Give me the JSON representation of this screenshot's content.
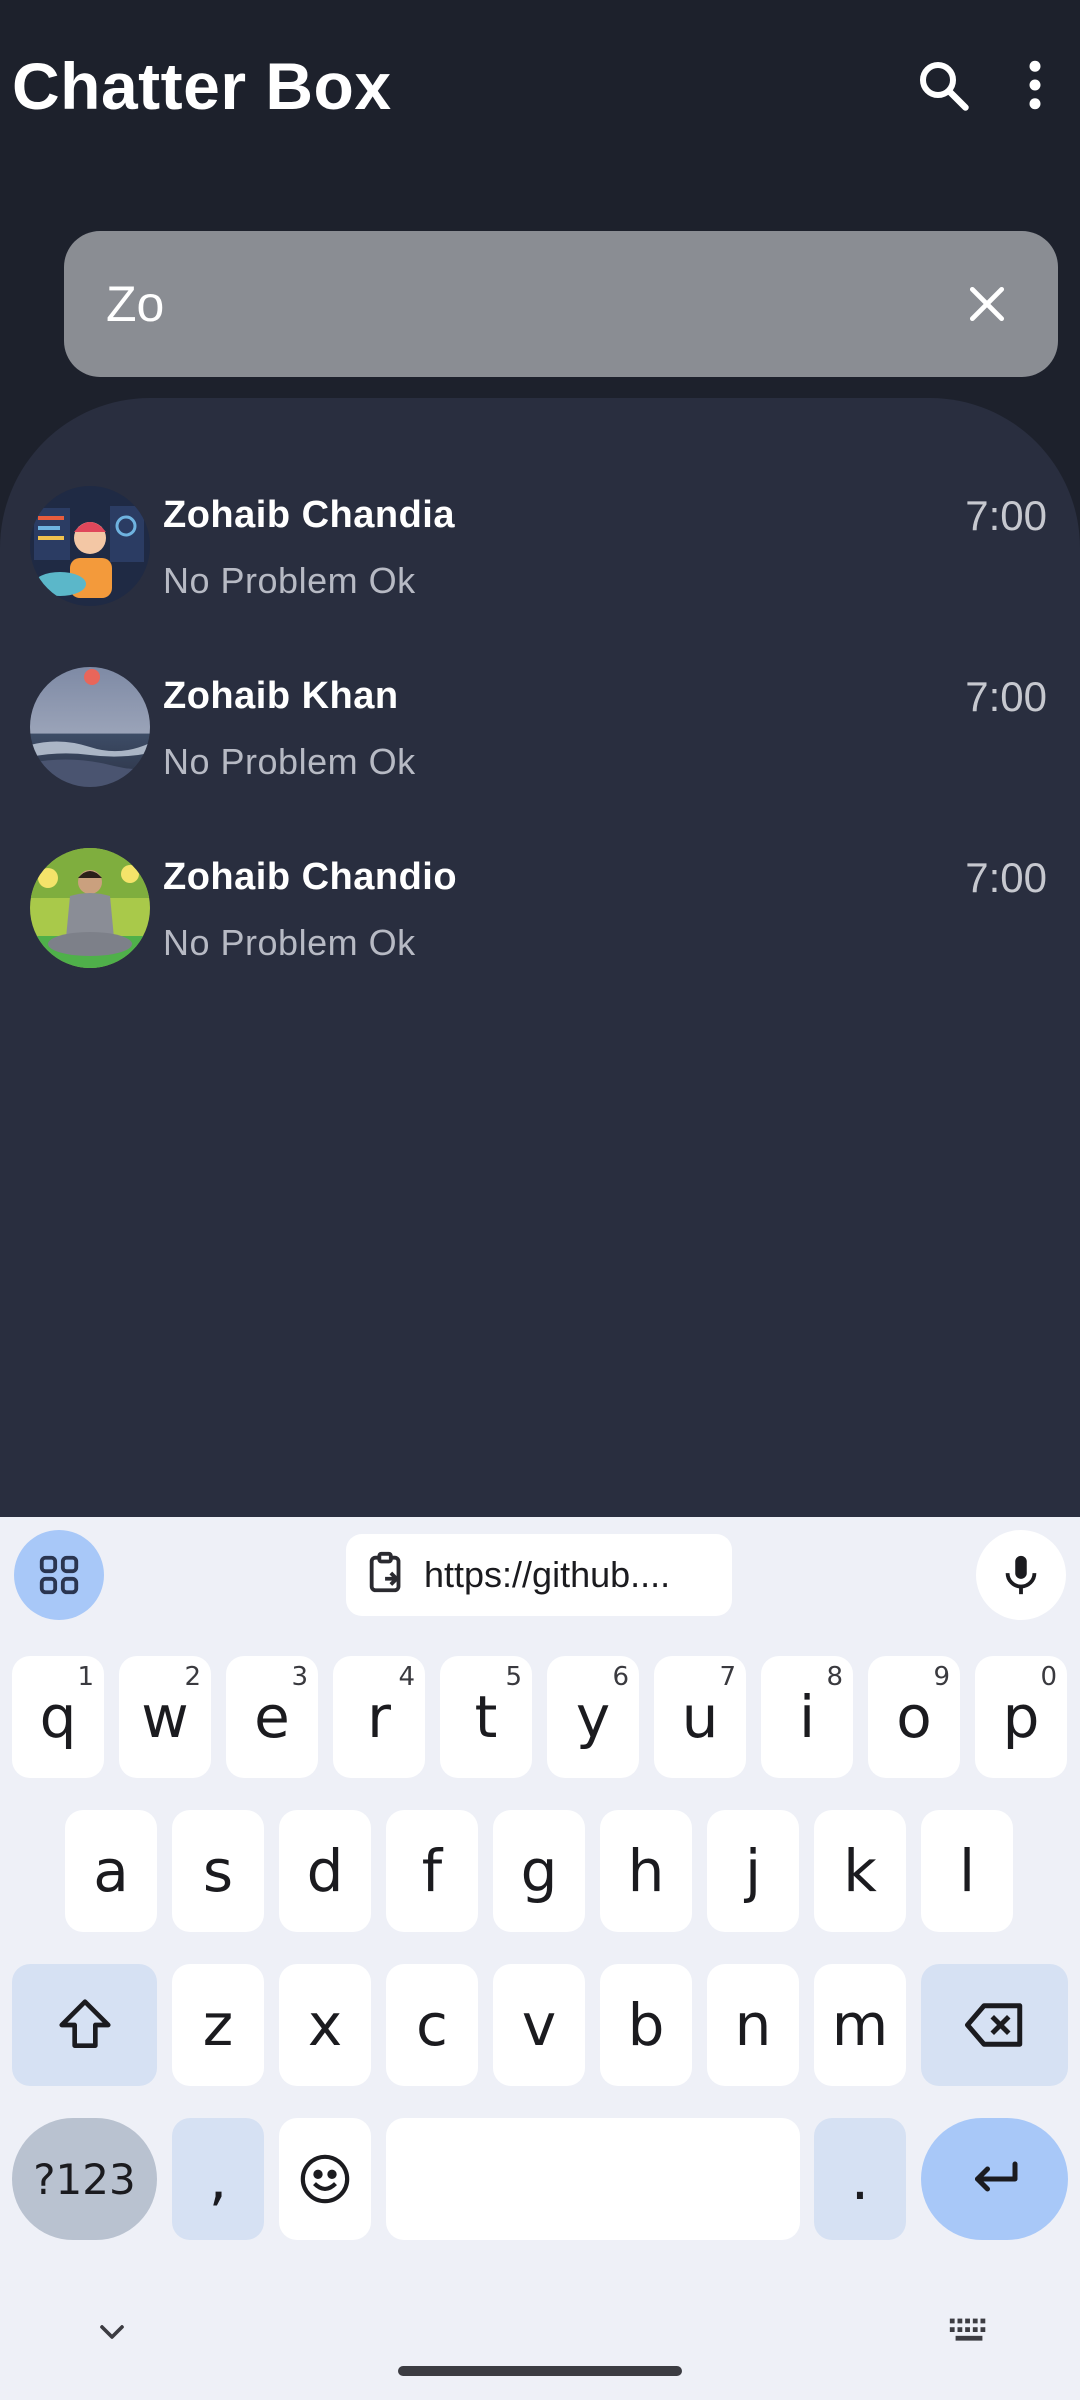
{
  "app": {
    "title": "Chatter Box",
    "search_icon": "search-icon",
    "menu_icon": "more-vert-icon"
  },
  "search": {
    "value": "Zo",
    "clear_icon": "close-icon"
  },
  "chats": [
    {
      "name": "Zohaib Chandia",
      "message": "No Problem Ok",
      "time": "7:00"
    },
    {
      "name": "Zohaib Khan",
      "message": "No Problem Ok",
      "time": "7:00"
    },
    {
      "name": "Zohaib Chandio",
      "message": "No Problem Ok",
      "time": "7:00"
    }
  ],
  "keyboard": {
    "clipboard_text": "https://github....",
    "row1": [
      {
        "key": "q",
        "hint": "1"
      },
      {
        "key": "w",
        "hint": "2"
      },
      {
        "key": "e",
        "hint": "3"
      },
      {
        "key": "r",
        "hint": "4"
      },
      {
        "key": "t",
        "hint": "5"
      },
      {
        "key": "y",
        "hint": "6"
      },
      {
        "key": "u",
        "hint": "7"
      },
      {
        "key": "i",
        "hint": "8"
      },
      {
        "key": "o",
        "hint": "9"
      },
      {
        "key": "p",
        "hint": "0"
      }
    ],
    "row2": [
      "a",
      "s",
      "d",
      "f",
      "g",
      "h",
      "j",
      "k",
      "l"
    ],
    "row3": [
      "z",
      "x",
      "c",
      "v",
      "b",
      "n",
      "m"
    ],
    "symbols_label": "?123",
    "comma": ",",
    "period": "."
  },
  "colors": {
    "background": "#1d212c",
    "list_panel": "#292e3f",
    "search_bar": "#8a8d93",
    "keyboard_bg": "#eef0f7",
    "key_fn": "#d6e1f3",
    "enter_key": "#a8c8f8"
  }
}
